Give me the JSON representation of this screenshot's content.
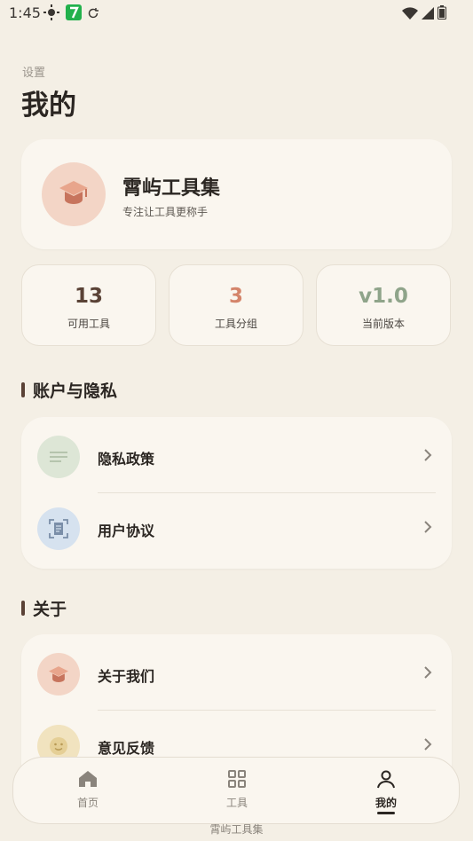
{
  "status_bar": {
    "time": "1:45",
    "left_icons": [
      "sun-weather-icon",
      "app-7-icon",
      "sync-icon"
    ],
    "right_icons": [
      "wifi-icon",
      "signal-icon",
      "battery-icon"
    ]
  },
  "header": {
    "subtitle": "设置",
    "title": "我的"
  },
  "profile": {
    "name": "霄屿工具集",
    "tagline": "专注让工具更称手",
    "icon": "graduation-cap-icon"
  },
  "stats": [
    {
      "value": "13",
      "label": "可用工具",
      "color": "#5a4236"
    },
    {
      "value": "3",
      "label": "工具分组",
      "color": "#d4846a"
    },
    {
      "value": "v1.0",
      "label": "当前版本",
      "color": "#8fa48a"
    }
  ],
  "sections": {
    "account": {
      "title": "账户与隐私",
      "items": [
        {
          "label": "隐私政策",
          "icon": "notes-icon"
        },
        {
          "label": "用户协议",
          "icon": "document-scan-icon"
        }
      ]
    },
    "about": {
      "title": "关于",
      "items": [
        {
          "label": "关于我们",
          "icon": "graduation-cap-icon"
        },
        {
          "label": "意见反馈",
          "icon": "smiley-face-icon"
        }
      ]
    }
  },
  "bottom_nav": [
    {
      "label": "首页",
      "icon": "home-icon",
      "active": false
    },
    {
      "label": "工具",
      "icon": "grid-icon",
      "active": false
    },
    {
      "label": "我的",
      "icon": "user-icon",
      "active": true
    }
  ],
  "footer": {
    "text": "霄屿工具集"
  },
  "colors": {
    "background": "#f4efe5",
    "card": "#faf6ef",
    "accent_peach": "#f3d5c6",
    "accent_green": "#dde6d6",
    "accent_blue": "#d6e2ef",
    "accent_yellow": "#f1e3bf"
  }
}
